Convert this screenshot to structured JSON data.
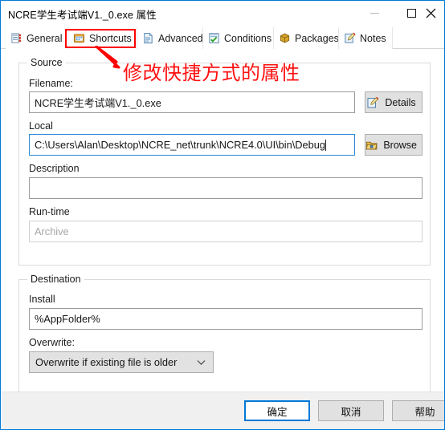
{
  "window": {
    "title": "NCRE学生考试端V1._0.exe 属性",
    "accent_color": "#0078d7",
    "controls": {
      "minimize": "minimize",
      "maximize": "maximize",
      "close": "close"
    }
  },
  "tabs": [
    {
      "label": "General",
      "icon": "list-icon",
      "selected": false
    },
    {
      "label": "Shortcuts",
      "icon": "shortcut-icon",
      "selected": true
    },
    {
      "label": "Advanced",
      "icon": "document-icon",
      "selected": false
    },
    {
      "label": "Conditions",
      "icon": "checklist-icon",
      "selected": false
    },
    {
      "label": "Packages",
      "icon": "package-icon",
      "selected": false
    },
    {
      "label": "Notes",
      "icon": "notes-icon",
      "selected": false
    }
  ],
  "annotation": {
    "text": "修改快捷方式的属性",
    "color": "#ff0000",
    "highlight_target": "Shortcuts"
  },
  "source": {
    "group_title": "Source",
    "filename_label": "Filename:",
    "filename_value": "NCRE学生考试端V1._0.exe",
    "details_button": "Details",
    "details_icon": "edit-note-icon",
    "local_label": "Local",
    "local_value": "C:\\Users\\Alan\\Desktop\\NCRE_net\\trunk\\NCRE4.0\\UI\\bin\\Debug",
    "browse_button": "Browse",
    "browse_icon": "folder-open-icon",
    "description_label": "Description",
    "description_value": "",
    "runtime_label": "Run-time",
    "runtime_placeholder": "Archive",
    "runtime_value": ""
  },
  "destination": {
    "group_title": "Destination",
    "install_label": "Install",
    "install_value": "%AppFolder%",
    "overwrite_label": "Overwrite:",
    "overwrite_value": "Overwrite if existing file is older"
  },
  "footer": {
    "ok": "确定",
    "cancel": "取消",
    "help": "帮助"
  }
}
